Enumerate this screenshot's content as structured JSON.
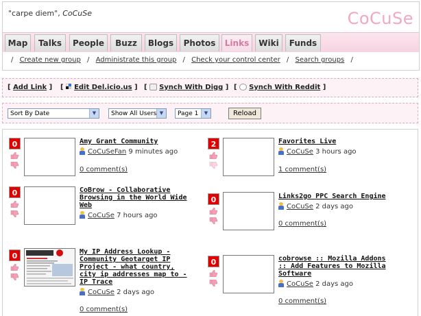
{
  "header": {
    "motto": "\"carpe diem\",",
    "motto_author": "CoCuSe",
    "logo": "CoCuSe"
  },
  "tabs": [
    {
      "label": "Map"
    },
    {
      "label": "Talks"
    },
    {
      "label": "People"
    },
    {
      "label": "Buzz"
    },
    {
      "label": "Blogs"
    },
    {
      "label": "Photos"
    },
    {
      "label": "Links",
      "active": true
    },
    {
      "label": "Wiki"
    },
    {
      "label": "Funds"
    }
  ],
  "subnav": [
    "Create new group",
    "Administrate this group",
    "Check your control center",
    "Search groups"
  ],
  "linkbar": {
    "add": "Add Link",
    "delicious": "Edit Del.icio.us",
    "digg": "Synch With Digg",
    "reddit": "Synch With Reddit"
  },
  "filters": {
    "sort": "Sort By Date",
    "users": "Show All Users",
    "page": "Page 1",
    "reload": "Reload"
  },
  "links": [
    {
      "votes": "0",
      "title": "Amy Grant Community",
      "user": "CoCuSeFan",
      "time": "9 minutes ago",
      "comments": "0 comment(s)"
    },
    {
      "votes": "2",
      "title": "Favorites Live",
      "user": "CoCuSe",
      "time": "3 hours ago",
      "comments": "1 comment(s)"
    },
    {
      "votes": "0",
      "title": "CoBrow - Collaborative Browsing in the World Wide Web",
      "user": "CoCuSe",
      "time": "7 hours ago",
      "comments": "0 comment(s)"
    },
    {
      "votes": "0",
      "title": "Links2go PPC Search Engine",
      "user": "CoCuSe",
      "time": "2 days ago",
      "comments": "0 comment(s)"
    },
    {
      "votes": "0",
      "title": "My IP Address Lookup - Community Geotarget IP Project - what country, city ip addresses map to - IP Trace",
      "user": "CoCuSe",
      "time": "2 days ago",
      "comments": "0 comment(s)"
    },
    {
      "votes": "0",
      "title": "cobrowse :: Mozilla Addons :: Add Features to Mozilla Software",
      "user": "CoCuSe",
      "time": "2 days ago",
      "comments": "0 comment(s)"
    }
  ],
  "colors": {
    "logo": "#f4a7c3",
    "active_tab": "#d77aa0",
    "vote_box": "#e00000"
  }
}
